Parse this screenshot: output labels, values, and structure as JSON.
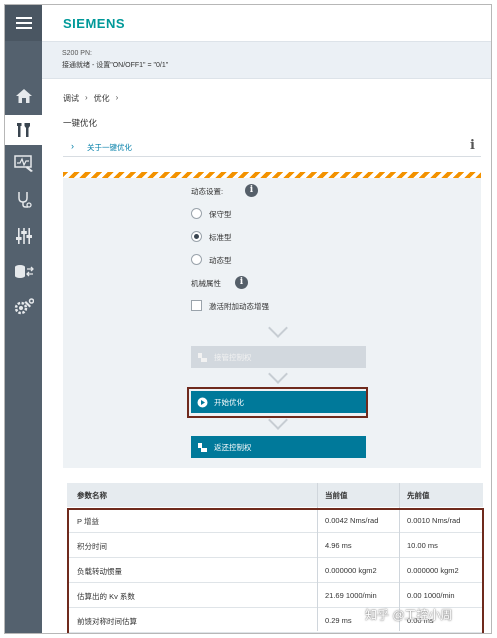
{
  "header": {
    "brand": "SIEMENS",
    "device_name": "S200 PN:",
    "device_status": "接通就绪 - 设置\"ON/OFF1\" = \"0/1\""
  },
  "sidebar": {
    "items": [
      {
        "icon": "home-icon"
      },
      {
        "icon": "tools-icon",
        "active": true
      },
      {
        "icon": "monitor-icon"
      },
      {
        "icon": "diagnostics-icon"
      },
      {
        "icon": "sliders-icon"
      },
      {
        "icon": "data-transfer-icon"
      },
      {
        "icon": "settings-wrench-icon"
      }
    ]
  },
  "breadcrumb": [
    "调试",
    "优化"
  ],
  "page_title": "一键优化",
  "about_link": "关于一键优化",
  "dynamic": {
    "label": "动态设置:",
    "options": [
      {
        "label": "保守型",
        "selected": false
      },
      {
        "label": "标准型",
        "selected": true
      },
      {
        "label": "动态型",
        "selected": false
      }
    ]
  },
  "mechanical": {
    "label": "机械属性",
    "checkbox_label": "激活附加动态增强",
    "checked": false
  },
  "buttons": {
    "take_control": "接管控制权",
    "start_optimize": "开始优化",
    "return_control": "返还控制权"
  },
  "table": {
    "headers": [
      "参数名称",
      "当前值",
      "先前值"
    ],
    "rows": [
      [
        "P 增益",
        "0.0042 Nms/rad",
        "0.0010 Nms/rad"
      ],
      [
        "积分时间",
        "4.96 ms",
        "10.00 ms"
      ],
      [
        "负载转动惯量",
        "0.000000 kgm2",
        "0.000000 kgm2"
      ],
      [
        "估算出的 Kv 系数",
        "21.69 1000/min",
        "0.00 1000/min"
      ],
      [
        "前馈对称时间估算",
        "0.29 ms",
        "0.00 ms"
      ]
    ]
  },
  "watermark": "知乎 @工控小周",
  "colors": {
    "brand": "#009999",
    "sidebar": "#54616e",
    "primary_button": "#00799a",
    "highlight_border": "#6f2a1d",
    "hatch": "#f39200"
  }
}
